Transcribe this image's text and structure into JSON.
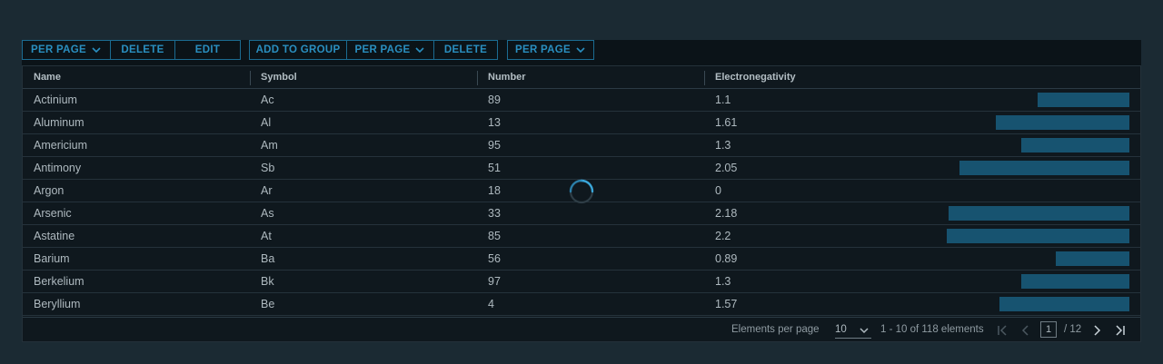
{
  "toolbar": {
    "group1": [
      "PER PAGE",
      "DELETE",
      "EDIT"
    ],
    "group2": [
      "ADD TO GROUP",
      "PER PAGE",
      "DELETE"
    ],
    "group3": [
      "PER PAGE"
    ]
  },
  "columns": [
    "Name",
    "Symbol",
    "Number",
    "Electronegativity"
  ],
  "rows": [
    {
      "name": "Actinium",
      "symbol": "Ac",
      "number": "89",
      "en": "1.1",
      "level": 1.1
    },
    {
      "name": "Aluminum",
      "symbol": "Al",
      "number": "13",
      "en": "1.61",
      "level": 1.61
    },
    {
      "name": "Americium",
      "symbol": "Am",
      "number": "95",
      "en": "1.3",
      "level": 1.3
    },
    {
      "name": "Antimony",
      "symbol": "Sb",
      "number": "51",
      "en": "2.05",
      "level": 2.05
    },
    {
      "name": "Argon",
      "symbol": "Ar",
      "number": "18",
      "en": "0",
      "level": 0
    },
    {
      "name": "Arsenic",
      "symbol": "As",
      "number": "33",
      "en": "2.18",
      "level": 2.18
    },
    {
      "name": "Astatine",
      "symbol": "At",
      "number": "85",
      "en": "2.2",
      "level": 2.2
    },
    {
      "name": "Barium",
      "symbol": "Ba",
      "number": "56",
      "en": "0.89",
      "level": 0.89
    },
    {
      "name": "Berkelium",
      "symbol": "Bk",
      "number": "97",
      "en": "1.3",
      "level": 1.3
    },
    {
      "name": "Beryllium",
      "symbol": "Be",
      "number": "4",
      "en": "1.57",
      "level": 1.57
    }
  ],
  "footer": {
    "per_page_label": "Elements per page",
    "per_page_value": "10",
    "range": "1 - 10 of 118 elements",
    "page": "1",
    "total_pages": "/ 12"
  },
  "colors": {
    "accent": "#2a8fc0",
    "bar": "#175370",
    "background": "#1b2a33"
  },
  "icons": [
    "chevron-down-icon",
    "first-page-icon",
    "prev-page-icon",
    "next-page-icon",
    "last-page-icon",
    "loading-spinner"
  ]
}
